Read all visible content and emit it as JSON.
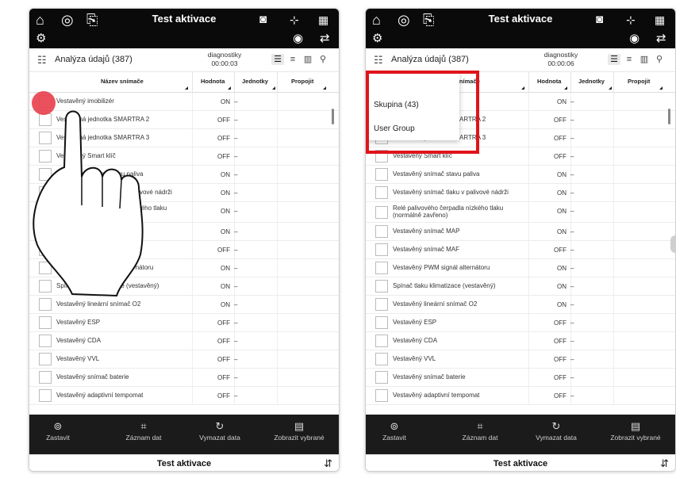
{
  "header": {
    "title": "Test aktivace",
    "icons": [
      "home-icon",
      "diagnostics-icon",
      "export-icon",
      "vci-icon",
      "zoom-icon",
      "grid-icon",
      "settings-icon",
      "oscilloscope-icon",
      "exit-icon"
    ]
  },
  "subbar": {
    "label": "Analýza údajů (387)",
    "diag_label": "diagnostiky",
    "view_icons": [
      "list-view-icon",
      "text-view-icon",
      "graph-view-icon",
      "search-icon"
    ]
  },
  "left": {
    "timer": "00:00:03"
  },
  "right": {
    "timer": "00:00:06"
  },
  "table": {
    "headers": {
      "name": "Název snímače",
      "value": "Hodnota",
      "unit": "Jednotky",
      "link": "Propojit"
    },
    "rows_left": [
      {
        "name": "Vestavěný imobilizér",
        "value": "ON",
        "unit": "–"
      },
      {
        "name": "Vestavěná jednotka SMARTRA 2",
        "value": "OFF",
        "unit": "–"
      },
      {
        "name": "Vestavěná jednotka SMARTRA 3",
        "value": "OFF",
        "unit": "–"
      },
      {
        "name": "Vestavěný Smart klíč",
        "value": "OFF",
        "unit": "–"
      },
      {
        "name": "Vestavěný snímač stavu paliva",
        "value": "ON",
        "unit": "–"
      },
      {
        "name": "Vestavěný snímač tlaku v palivové nádrži",
        "value": "ON",
        "unit": "–"
      },
      {
        "name": "Relé palivového čerpadla nízkého tlaku (normálně zavřeno)",
        "value": "ON",
        "unit": "–"
      },
      {
        "name": "Vestavěný snímač MAP",
        "value": "ON",
        "unit": "–"
      },
      {
        "name": "Vestavěný snímač MAF",
        "value": "OFF",
        "unit": "–"
      },
      {
        "name": "Vestavěný PWM signál alternátoru",
        "value": "ON",
        "unit": "–"
      },
      {
        "name": "Spínač tlaku klimatizace (vestavěný)",
        "value": "ON",
        "unit": "–"
      },
      {
        "name": "Vestavěný lineární snímač O2",
        "value": "ON",
        "unit": "–"
      },
      {
        "name": "Vestavěný ESP",
        "value": "OFF",
        "unit": "–"
      },
      {
        "name": "Vestavěný CDA",
        "value": "OFF",
        "unit": "–"
      },
      {
        "name": "Vestavěný VVL",
        "value": "OFF",
        "unit": "–"
      },
      {
        "name": "Vestavěný snímač baterie",
        "value": "OFF",
        "unit": "–"
      },
      {
        "name": "Vestavěný adaptivní tempomat",
        "value": "OFF",
        "unit": "–"
      }
    ],
    "rows_right": [
      {
        "name": "Vestavěný imobilizér",
        "value": "ON",
        "unit": "–"
      },
      {
        "name": "Vestavěná jednotka SMARTRA 2",
        "value": "OFF",
        "unit": "–"
      },
      {
        "name": "Vestavěná jednotka SMARTRA 3",
        "value": "OFF",
        "unit": "–"
      },
      {
        "name": "Vestavěný Smart klíč",
        "value": "OFF",
        "unit": "–"
      },
      {
        "name": "Vestavěný snímač stavu paliva",
        "value": "ON",
        "unit": "–"
      },
      {
        "name": "Vestavěný snímač tlaku v palivové nádrži",
        "value": "ON",
        "unit": "–"
      },
      {
        "name": "Relé palivového čerpadla nízkého tlaku (normálně zavřeno)",
        "value": "ON",
        "unit": "–"
      },
      {
        "name": "Vestavěný snímač MAP",
        "value": "ON",
        "unit": "–"
      },
      {
        "name": "Vestavěný snímač MAF",
        "value": "OFF",
        "unit": "–"
      },
      {
        "name": "Vestavěný PWM signál alternátoru",
        "value": "ON",
        "unit": "–"
      },
      {
        "name": "Spínač tlaku klimatizace (vestavěný)",
        "value": "ON",
        "unit": "–"
      },
      {
        "name": "Vestavěný lineární snímač O2",
        "value": "ON",
        "unit": "–"
      },
      {
        "name": "Vestavěný ESP",
        "value": "OFF",
        "unit": "–"
      },
      {
        "name": "Vestavěný CDA",
        "value": "OFF",
        "unit": "–"
      },
      {
        "name": "Vestavěný VVL",
        "value": "OFF",
        "unit": "–"
      },
      {
        "name": "Vestavěný snímač baterie",
        "value": "OFF",
        "unit": "–"
      },
      {
        "name": "Vestavěný adaptivní tempomat",
        "value": "OFF",
        "unit": "–"
      }
    ]
  },
  "dropdown": {
    "options": [
      "Skupina (43)",
      "User Group"
    ]
  },
  "bottom": {
    "stop": "Zastavit",
    "record": "Záznam dat",
    "clear": "Vymazat data",
    "show_selected": "Zobrazit vybrané"
  },
  "footer": {
    "title": "Test aktivace"
  },
  "colors": {
    "highlight": "#e0141b",
    "tap": "#e8424f",
    "bar": "#0a0a0a"
  }
}
